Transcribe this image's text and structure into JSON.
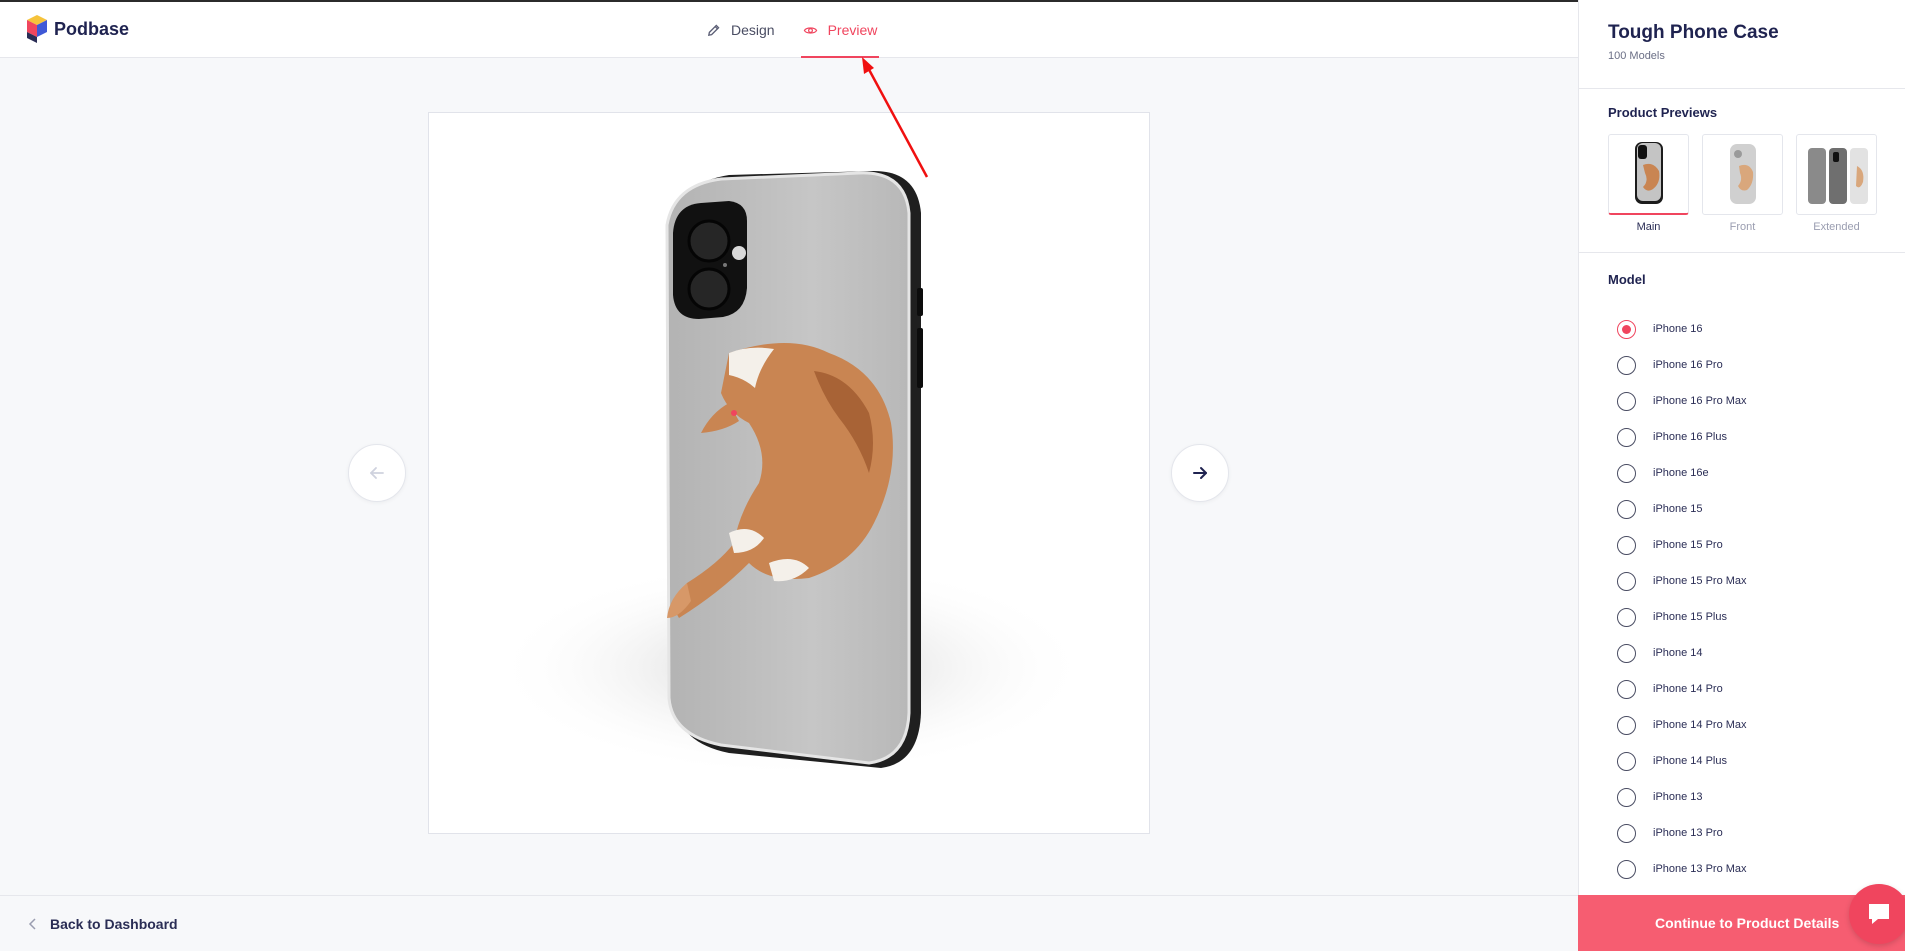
{
  "app": {
    "name": "Podbase"
  },
  "header": {
    "tabs": [
      {
        "label": "Design",
        "icon": "pencil-icon",
        "active": false
      },
      {
        "label": "Preview",
        "icon": "eye-icon",
        "active": true
      }
    ]
  },
  "footer": {
    "back_label": "Back to Dashboard"
  },
  "product": {
    "title": "Tough Phone Case",
    "subtitle": "100 Models"
  },
  "previews": {
    "title": "Product Previews",
    "items": [
      {
        "label": "Main",
        "active": true
      },
      {
        "label": "Front",
        "active": false
      },
      {
        "label": "Extended",
        "active": false
      }
    ]
  },
  "model": {
    "title": "Model",
    "selected": "iPhone 16",
    "options": [
      "iPhone 16",
      "iPhone 16 Pro",
      "iPhone 16 Pro Max",
      "iPhone 16 Plus",
      "iPhone 16e",
      "iPhone 15",
      "iPhone 15 Pro",
      "iPhone 15 Pro Max",
      "iPhone 15 Plus",
      "iPhone 14",
      "iPhone 14 Pro",
      "iPhone 14 Pro Max",
      "iPhone 14 Plus",
      "iPhone 13",
      "iPhone 13 Pro",
      "iPhone 13 Pro Max"
    ]
  },
  "actions": {
    "continue_label": "Continue to Product Details"
  },
  "colors": {
    "accent": "#f0455e",
    "button": "#f65d71",
    "navy": "#1f2350"
  }
}
